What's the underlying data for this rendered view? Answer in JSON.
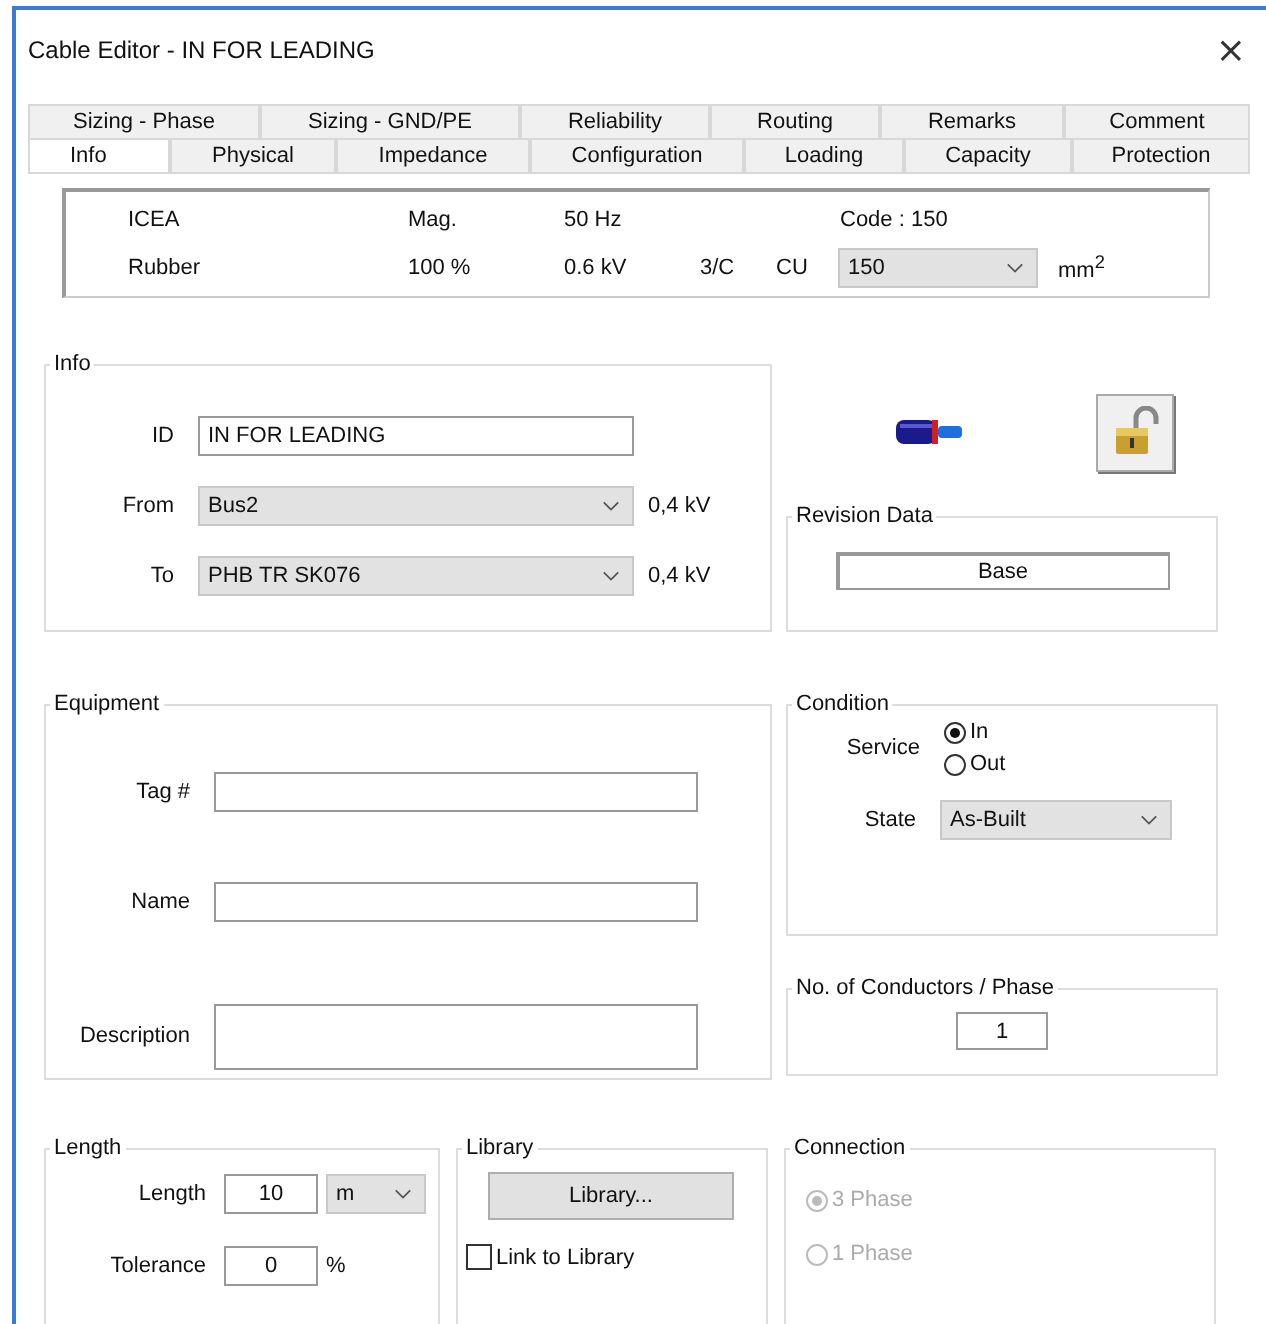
{
  "window": {
    "title": "Cable Editor - IN FOR LEADING",
    "close": "×"
  },
  "tab_rows": [
    {
      "tabs": [
        {
          "label": "Sizing - Phase",
          "selected": false
        },
        {
          "label": "Sizing - GND/PE",
          "selected": false
        },
        {
          "label": "Reliability",
          "selected": false
        },
        {
          "label": "Routing",
          "selected": false
        },
        {
          "label": "Remarks",
          "selected": false
        },
        {
          "label": "Comment",
          "selected": false
        }
      ]
    },
    {
      "tabs": [
        {
          "label": "Info",
          "selected": true
        },
        {
          "label": "Physical",
          "selected": false
        },
        {
          "label": "Impedance",
          "selected": false
        },
        {
          "label": "Configuration",
          "selected": false
        },
        {
          "label": "Loading",
          "selected": false
        },
        {
          "label": "Capacity",
          "selected": false
        },
        {
          "label": "Protection",
          "selected": false
        }
      ]
    }
  ],
  "summary": {
    "standard": "ICEA",
    "mag": "Mag.",
    "frequency": "50 Hz",
    "code": "Code : 150",
    "insulation": "Rubber",
    "percent": "100 %",
    "voltage": "0.6 kV",
    "cores": "3/C",
    "conductor": "CU",
    "size": "150",
    "unit": "mm$^{2}$"
  },
  "info": {
    "title": "Info",
    "fields": [
      {
        "kind": "text",
        "label": "ID",
        "value": "IN FOR LEADING"
      },
      {
        "kind": "dropdown",
        "label": "From",
        "value": "Bus2",
        "suffix": "0,4 kV"
      },
      {
        "kind": "dropdown",
        "label": "To",
        "value": "PHB TR SK076",
        "suffix": "0,4 kV"
      }
    ]
  },
  "revision": {
    "title": "Revision Data",
    "value": "Base"
  },
  "equipment": {
    "title": "Equipment",
    "fields": [
      {
        "kind": "text",
        "label": "Tag #"
      },
      {
        "kind": "text",
        "label": "Name"
      },
      {
        "kind": "multiline",
        "label": "Description"
      }
    ]
  },
  "condition": {
    "title": "Condition",
    "service_label": "Service",
    "service_options": [
      {
        "label": "In",
        "selected": true
      },
      {
        "label": "Out",
        "selected": false
      }
    ],
    "state_label": "State",
    "state": "As-Built"
  },
  "conductors": {
    "title": "No. of Conductors / Phase",
    "value": "1"
  },
  "length": {
    "title": "Length",
    "length_label": "Length",
    "length": "10",
    "unit": "m",
    "tolerance_label": "Tolerance",
    "tolerance": "0",
    "tolerance_unit": "%"
  },
  "library": {
    "title": "Library",
    "button": "Library...",
    "link_label": "Link to Library",
    "link_checked": false
  },
  "connection": {
    "title": "Connection",
    "disabled": true,
    "options": [
      {
        "label": "3 Phase",
        "selected": true
      },
      {
        "label": "1 Phase",
        "selected": false
      }
    ]
  }
}
